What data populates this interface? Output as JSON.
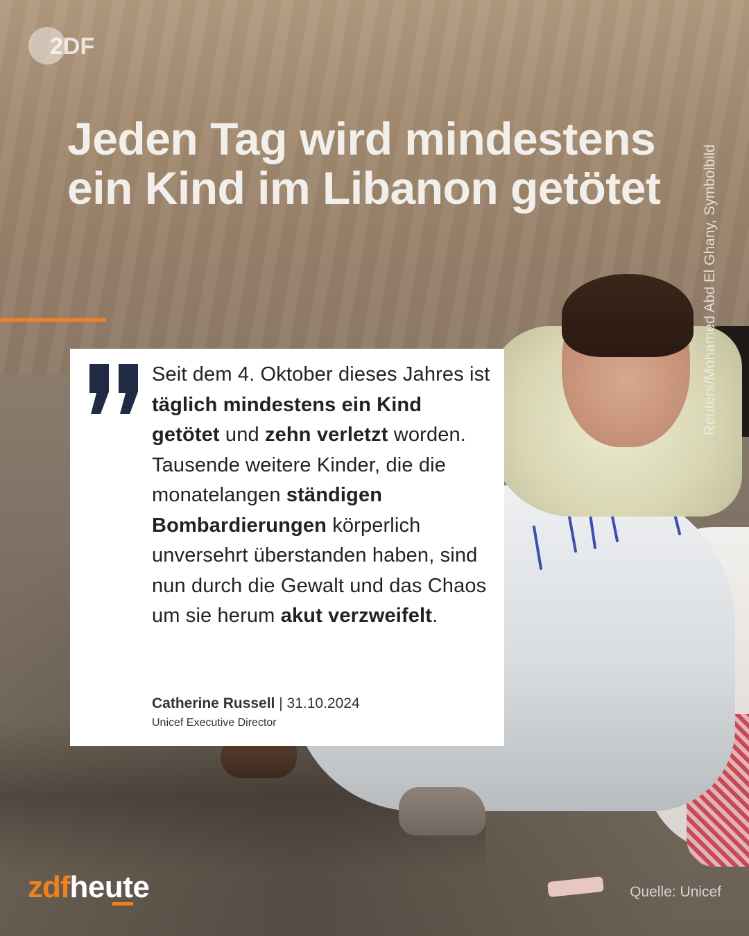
{
  "logo": {
    "label": "ZDF"
  },
  "headline": "Jeden Tag wird mindestens ein Kind im Libanon getötet",
  "photo_credit": "Reuters/Mohamed Abd El Ghany, Symbolbild",
  "quote": {
    "segments": [
      {
        "text": "Seit dem 4. Oktober dieses Jahres ist ",
        "bold": false
      },
      {
        "text": "täglich mindestens ein Kind getötet",
        "bold": true
      },
      {
        "text": " und ",
        "bold": false
      },
      {
        "text": "zehn verletzt",
        "bold": true
      },
      {
        "text": " worden. Tausende weitere Kinder, die die monatelangen ",
        "bold": false
      },
      {
        "text": "ständigen Bombardierungen",
        "bold": true
      },
      {
        "text": " körperlich unversehrt überstanden haben, sind nun durch die Gewalt und das Chaos um sie herum ",
        "bold": false
      },
      {
        "text": "akut verzweifelt",
        "bold": true
      },
      {
        "text": ".",
        "bold": false
      }
    ],
    "author": "Catherine Russell",
    "separator": " | ",
    "date": "31.10.2024",
    "role": "Unicef Executive Director"
  },
  "brand": {
    "zdf": "zdf",
    "heute": "heute"
  },
  "source": "Quelle: Unicef",
  "colors": {
    "accent": "#f0821e",
    "headline": "#f2efeb",
    "card_bg": "#ffffff",
    "quote_text": "#222222"
  },
  "icons": {
    "quote_mark": "closing-quote-icon",
    "logo": "zdf-logo-icon"
  }
}
